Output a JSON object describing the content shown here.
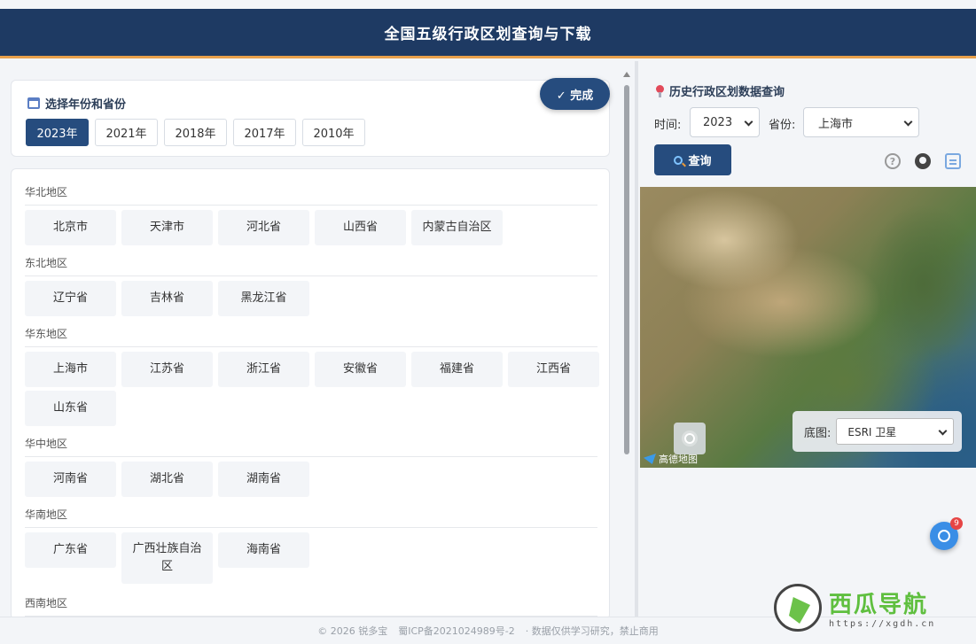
{
  "header": {
    "title": "全国五级行政区划查询与下载"
  },
  "year_panel": {
    "title": "选择年份和省份",
    "done_label": "✓ 完成",
    "years": [
      "2023年",
      "2021年",
      "2018年",
      "2017年",
      "2010年"
    ],
    "selected_year": "2023年"
  },
  "regions": [
    {
      "name": "华北地区",
      "provinces": [
        "北京市",
        "天津市",
        "河北省",
        "山西省",
        "内蒙古自治区"
      ]
    },
    {
      "name": "东北地区",
      "provinces": [
        "辽宁省",
        "吉林省",
        "黑龙江省"
      ]
    },
    {
      "name": "华东地区",
      "provinces": [
        "上海市",
        "江苏省",
        "浙江省",
        "安徽省",
        "福建省",
        "江西省",
        "山东省"
      ]
    },
    {
      "name": "华中地区",
      "provinces": [
        "河南省",
        "湖北省",
        "湖南省"
      ]
    },
    {
      "name": "华南地区",
      "provinces": [
        "广东省",
        "广西壮族自治区",
        "海南省"
      ]
    },
    {
      "name": "西南地区",
      "provinces": []
    }
  ],
  "query_panel": {
    "title": "历史行政区划数据查询",
    "time_label": "时间:",
    "time_value": "2023",
    "province_label": "省份:",
    "province_value": "上海市",
    "query_label": "查询",
    "help_glyph": "?"
  },
  "map": {
    "basemap_label": "底图:",
    "basemap_value": "ESRI 卫星",
    "attribution": "高德地图"
  },
  "float_badge": "9",
  "footer": {
    "copyright": "© 2026 锐多宝",
    "icp": "蜀ICP备2021024989号-2",
    "note": "· 数据仅供学习研究，禁止商用"
  },
  "watermark": {
    "title": "西瓜导航",
    "url": "https://xgdh.cn"
  },
  "colors": {
    "header": "#1e3a63",
    "accent": "#e8a04c",
    "primary": "#264c7e"
  }
}
